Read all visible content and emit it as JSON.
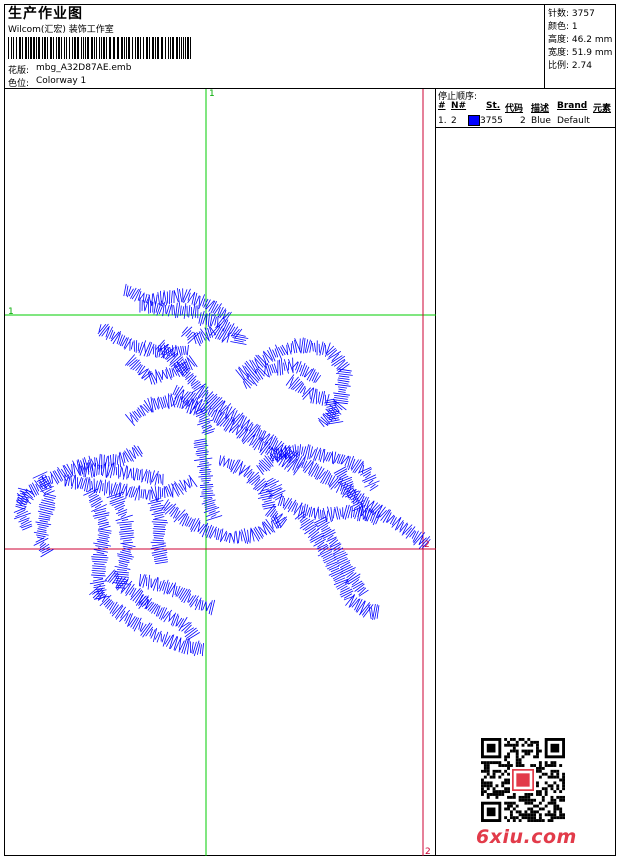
{
  "header": {
    "title": "生产作业图",
    "company": "Wilcom(汇宏) 装饰工作室",
    "design_label": "花版:",
    "design_value": "mbg_A32D87AE.emb",
    "colorway_label": "色位:",
    "colorway_value": "Colorway 1"
  },
  "stats": [
    {
      "label": "针数:",
      "value": "3757"
    },
    {
      "label": "颜色:",
      "value": "1"
    },
    {
      "label": "高度:",
      "value": "46.2 mm"
    },
    {
      "label": "宽度:",
      "value": "51.9 mm"
    },
    {
      "label": "比例:",
      "value": "2.74"
    }
  ],
  "stop_sequence": {
    "title": "停止顺序:",
    "headers": [
      "#",
      "N#",
      "St.",
      "代码",
      "描述",
      "Brand",
      "元素"
    ],
    "rows": [
      {
        "num": "1.",
        "needle": "2",
        "stitches": "3755",
        "code": "2",
        "description": "Blue",
        "brand": "Default",
        "color": "#0000ff"
      }
    ]
  },
  "markers": {
    "top": "1",
    "left": "1",
    "right": "2",
    "bottom": "2"
  },
  "colors": {
    "stitch": "#0000ff",
    "guide_green": "#00cc00",
    "guide_red": "#cc0033",
    "logo": "#e23b4a"
  },
  "watermark": {
    "logo_text": "6xiu.com"
  }
}
